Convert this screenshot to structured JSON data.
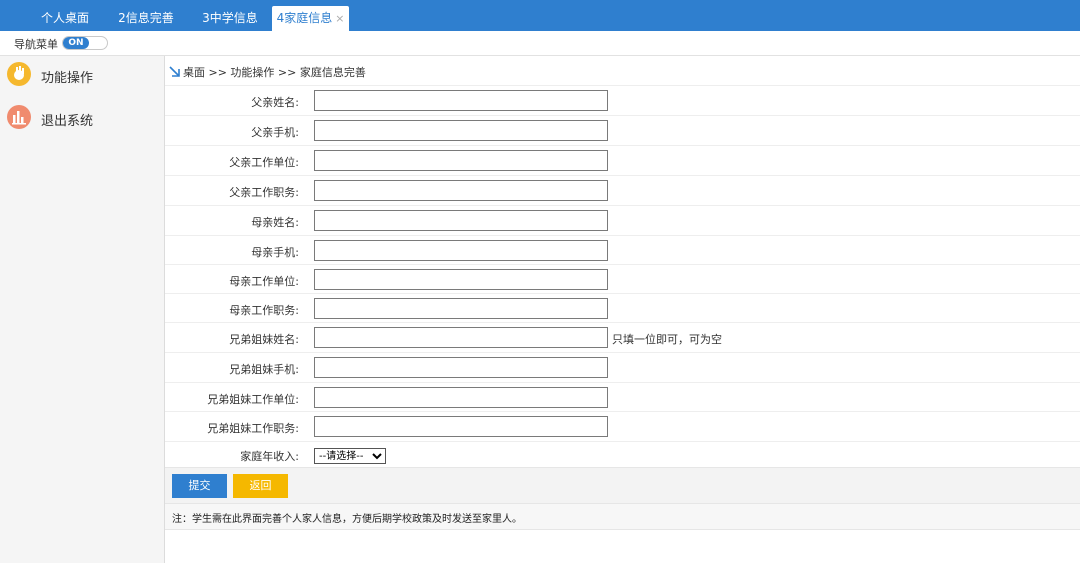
{
  "tabs": [
    {
      "label": "个人桌面"
    },
    {
      "label": "2信息完善"
    },
    {
      "label": "3中学信息"
    },
    {
      "label": "4家庭信息",
      "close": "×",
      "active": true
    }
  ],
  "nav": {
    "label": "导航菜单",
    "toggle": "ON"
  },
  "sidebar": {
    "items": [
      {
        "label": "功能操作",
        "icon": "hand-icon",
        "color": "#f5b82e"
      },
      {
        "label": "退出系统",
        "icon": "bar-chart-icon",
        "color": "#f08b6e"
      }
    ]
  },
  "breadcrumb": {
    "text": "桌面 >> 功能操作 >> 家庭信息完善"
  },
  "form": {
    "fields": [
      {
        "label": "父亲姓名:",
        "value": ""
      },
      {
        "label": "父亲手机:",
        "value": ""
      },
      {
        "label": "父亲工作单位:",
        "value": ""
      },
      {
        "label": "父亲工作职务:",
        "value": ""
      },
      {
        "label": "母亲姓名:",
        "value": ""
      },
      {
        "label": "母亲手机:",
        "value": ""
      },
      {
        "label": "母亲工作单位:",
        "value": ""
      },
      {
        "label": "母亲工作职务:",
        "value": ""
      },
      {
        "label": "兄弟姐妹姓名:",
        "value": "",
        "hint": "只填一位即可，可为空"
      },
      {
        "label": "兄弟姐妹手机:",
        "value": ""
      },
      {
        "label": "兄弟姐妹工作单位:",
        "value": ""
      },
      {
        "label": "兄弟姐妹工作职务:",
        "value": ""
      }
    ],
    "income": {
      "label": "家庭年收入:",
      "selected": "--请选择--"
    }
  },
  "buttons": {
    "submit": "提交",
    "back": "返回"
  },
  "note": "注：学生需在此界面完善个人家人信息，方便后期学校政策及时发送至家里人。",
  "colors": {
    "primary": "#2f7fcf",
    "submit": "#2f7fcf",
    "back": "#f5b800"
  }
}
